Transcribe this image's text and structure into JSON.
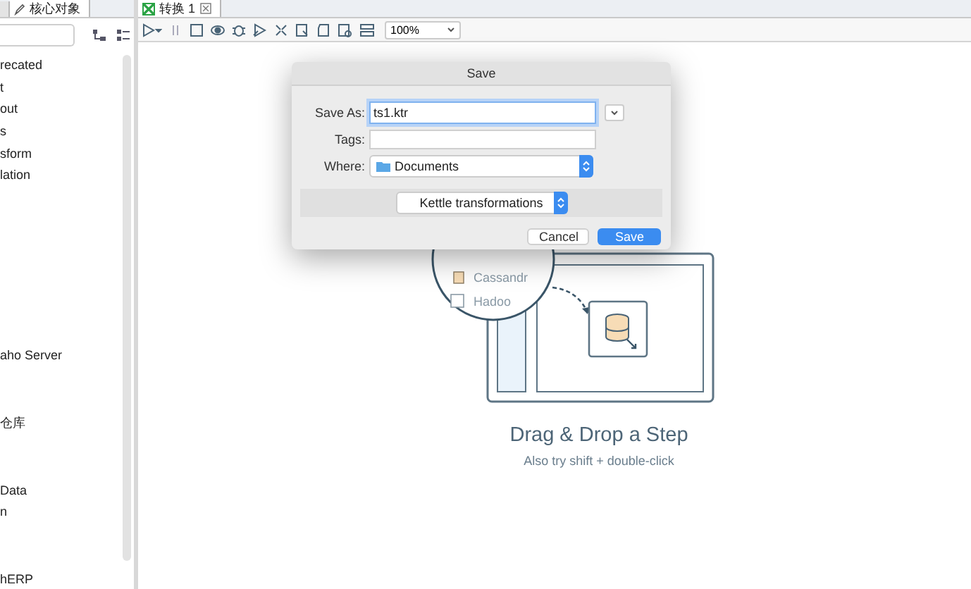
{
  "left_panel": {
    "tabs": [
      {
        "label": "核心对象",
        "selected": true
      }
    ],
    "tree_groups": [
      {
        "items": [
          "recated",
          "t",
          "out",
          "s",
          "sform",
          "lation"
        ]
      },
      {
        "items": [
          "aho Server"
        ]
      },
      {
        "items": [
          "仓库"
        ]
      },
      {
        "items": [
          "Data",
          "n"
        ]
      },
      {
        "items": [
          "hERP"
        ]
      }
    ]
  },
  "editor": {
    "tabs": [
      {
        "label": "转换 1",
        "selected": true
      }
    ],
    "zoom": "100%",
    "canvas": {
      "illustration": {
        "steps": [
          "Cassandr",
          "Hadoo"
        ]
      },
      "title": "Drag & Drop a Step",
      "hint": "Also try shift + double-click"
    }
  },
  "dialog": {
    "title": "Save",
    "fields": [
      {
        "label": "Save As:",
        "kind": "text",
        "value": "ts1.ktr"
      },
      {
        "label": "Tags:",
        "kind": "text"
      },
      {
        "label": "Where:",
        "kind": "folder",
        "value": "Documents"
      }
    ],
    "format": "Kettle transformations",
    "buttons": [
      {
        "label": "Cancel",
        "primary": false
      },
      {
        "label": "Save",
        "primary": true
      }
    ]
  }
}
